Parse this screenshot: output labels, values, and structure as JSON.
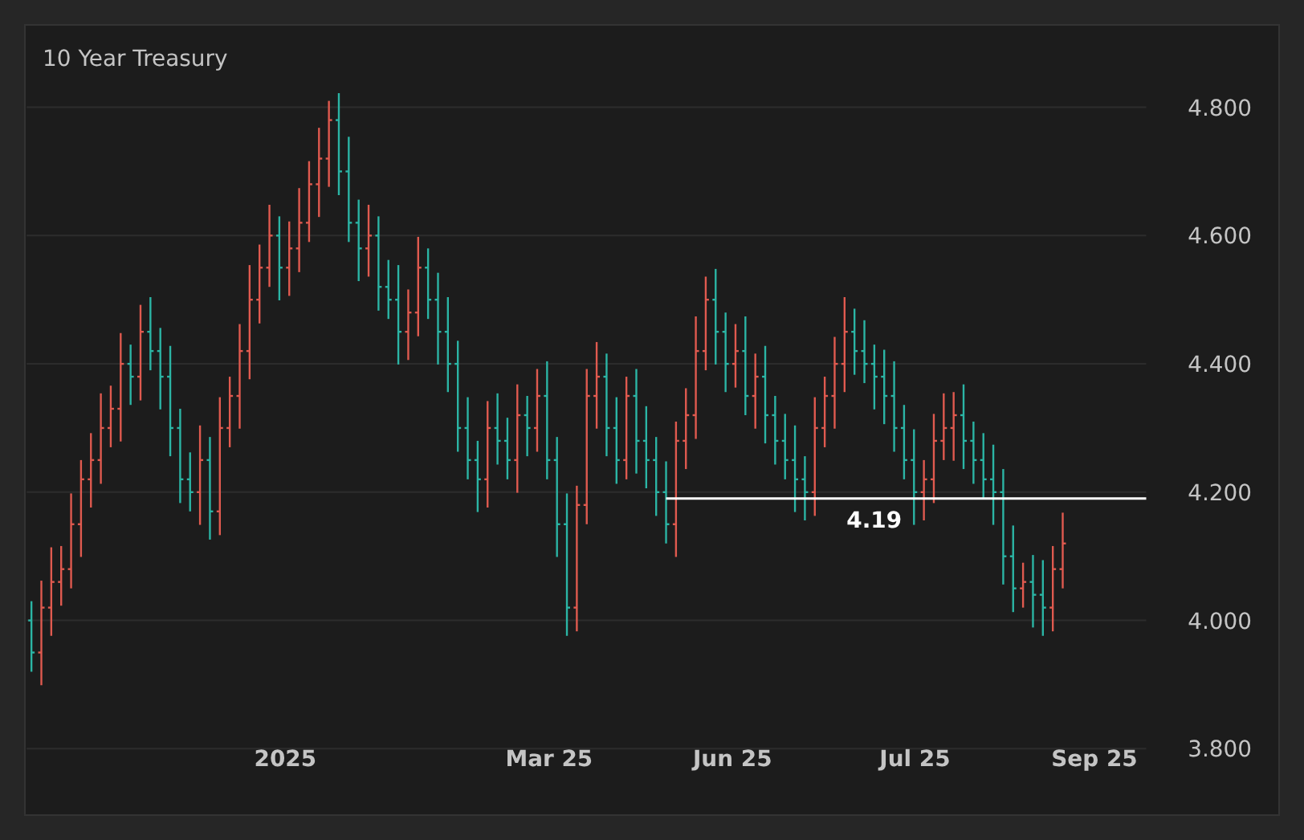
{
  "chart": {
    "title": "10 Year Treasury",
    "y_axis_labels": [
      "4.800",
      "4.600",
      "4.400",
      "4.200",
      "4.000",
      "3.800"
    ],
    "x_axis_labels": [
      "2025",
      "Mar 25",
      "Jun 25",
      "Jul 25",
      "Sep 25"
    ],
    "price_level_label": "4.19"
  }
}
